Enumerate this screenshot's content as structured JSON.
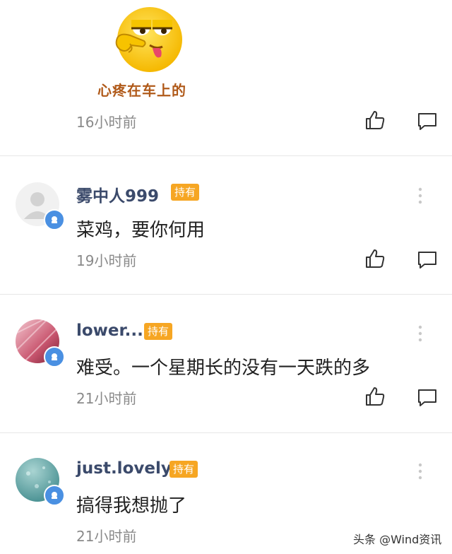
{
  "sticker_comment": {
    "sticker_icon": "smirk-finger-emoji-icon",
    "sticker_caption": "心疼在车上的",
    "time": "16小时前"
  },
  "comments": [
    {
      "username": "雾中人999",
      "tag": "持有",
      "text": "菜鸡，要你何用",
      "time": "19小时前",
      "avatar": "default-gray-avatar"
    },
    {
      "username": "lower...",
      "tag": "持有",
      "text": "难受。一个星期长的没有一天跌的多",
      "time": "21小时前",
      "avatar": "pink-photo-avatar"
    },
    {
      "username": "just.lovely",
      "tag": "持有",
      "text": "搞得我想抛了",
      "time": "21小时前",
      "avatar": "teal-raindrop-avatar"
    }
  ],
  "watermark": "头条 @Wind资讯",
  "colors": {
    "username": "#3b4a6b",
    "tag_bg": "#f6a623",
    "time": "#8a8a8a",
    "badge": "#4a90e2"
  }
}
